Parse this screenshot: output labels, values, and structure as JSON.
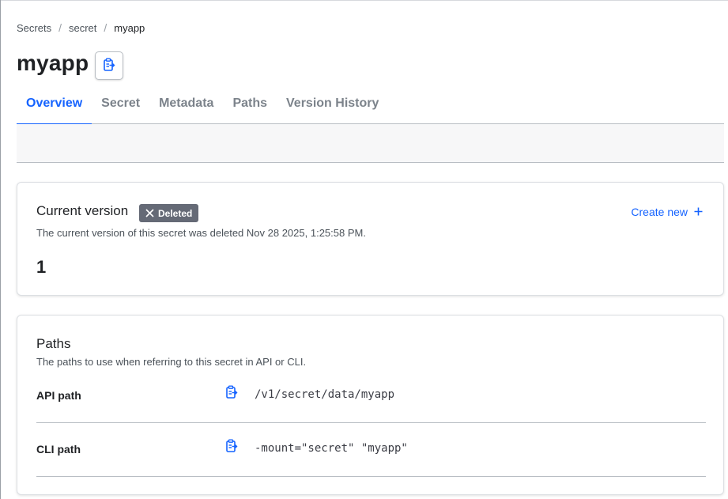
{
  "breadcrumb": {
    "items": [
      "Secrets",
      "secret"
    ],
    "separator": "/",
    "current": "myapp"
  },
  "page": {
    "title": "myapp",
    "copy_icon": "clipboard-copy-icon"
  },
  "tabs": [
    {
      "label": "Overview",
      "active": true
    },
    {
      "label": "Secret",
      "active": false
    },
    {
      "label": "Metadata",
      "active": false
    },
    {
      "label": "Paths",
      "active": false
    },
    {
      "label": "Version History",
      "active": false
    }
  ],
  "current_version": {
    "heading": "Current version",
    "badge": {
      "label": "Deleted",
      "icon": "x-icon",
      "color": "#656a76"
    },
    "description": "The current version of this secret was deleted Nov 28 2025, 1:25:58 PM.",
    "create_new_label": "Create new",
    "create_new_icon": "plus-icon",
    "version_number": "1"
  },
  "paths": {
    "heading": "Paths",
    "description": "The paths to use when referring to this secret in API or CLI.",
    "rows": [
      {
        "label": "API path",
        "value": "/v1/secret/data/myapp",
        "icon": "clipboard-copy-icon"
      },
      {
        "label": "CLI path",
        "value": "-mount=\"secret\" \"myapp\"",
        "icon": "clipboard-copy-icon"
      }
    ]
  },
  "colors": {
    "accent": "#1563ff",
    "text": "#1f2124",
    "muted": "#7c838b",
    "badge_bg": "#656a76"
  }
}
